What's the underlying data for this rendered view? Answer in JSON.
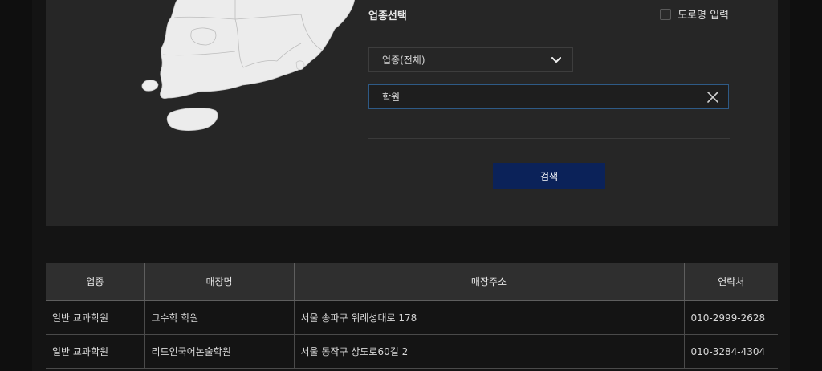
{
  "search": {
    "section_title": "업종선택",
    "road_name_label": "도로명 입력",
    "category_select": {
      "selected": "업종(전체)"
    },
    "keyword_input": {
      "value": "학원"
    },
    "search_button": "검색"
  },
  "results": {
    "columns": [
      "업종",
      "매장명",
      "매장주소",
      "연락처"
    ],
    "rows": [
      {
        "category": "일반 교과학원",
        "store": "그수학 학원",
        "address": "서울 송파구 위례성대로 178",
        "phone": "010-2999-2628"
      },
      {
        "category": "일반 교과학원",
        "store": "리드인국어논술학원",
        "address": "서울 동작구 상도로60길 2",
        "phone": "010-3284-4304"
      }
    ]
  },
  "colors": {
    "page_bg": "#141414",
    "panel_bg": "#262626",
    "accent_button": "#0b2259",
    "input_focus_border": "#2e5a86"
  },
  "icons": [
    "chevron-down-icon",
    "close-icon",
    "korea-map"
  ]
}
